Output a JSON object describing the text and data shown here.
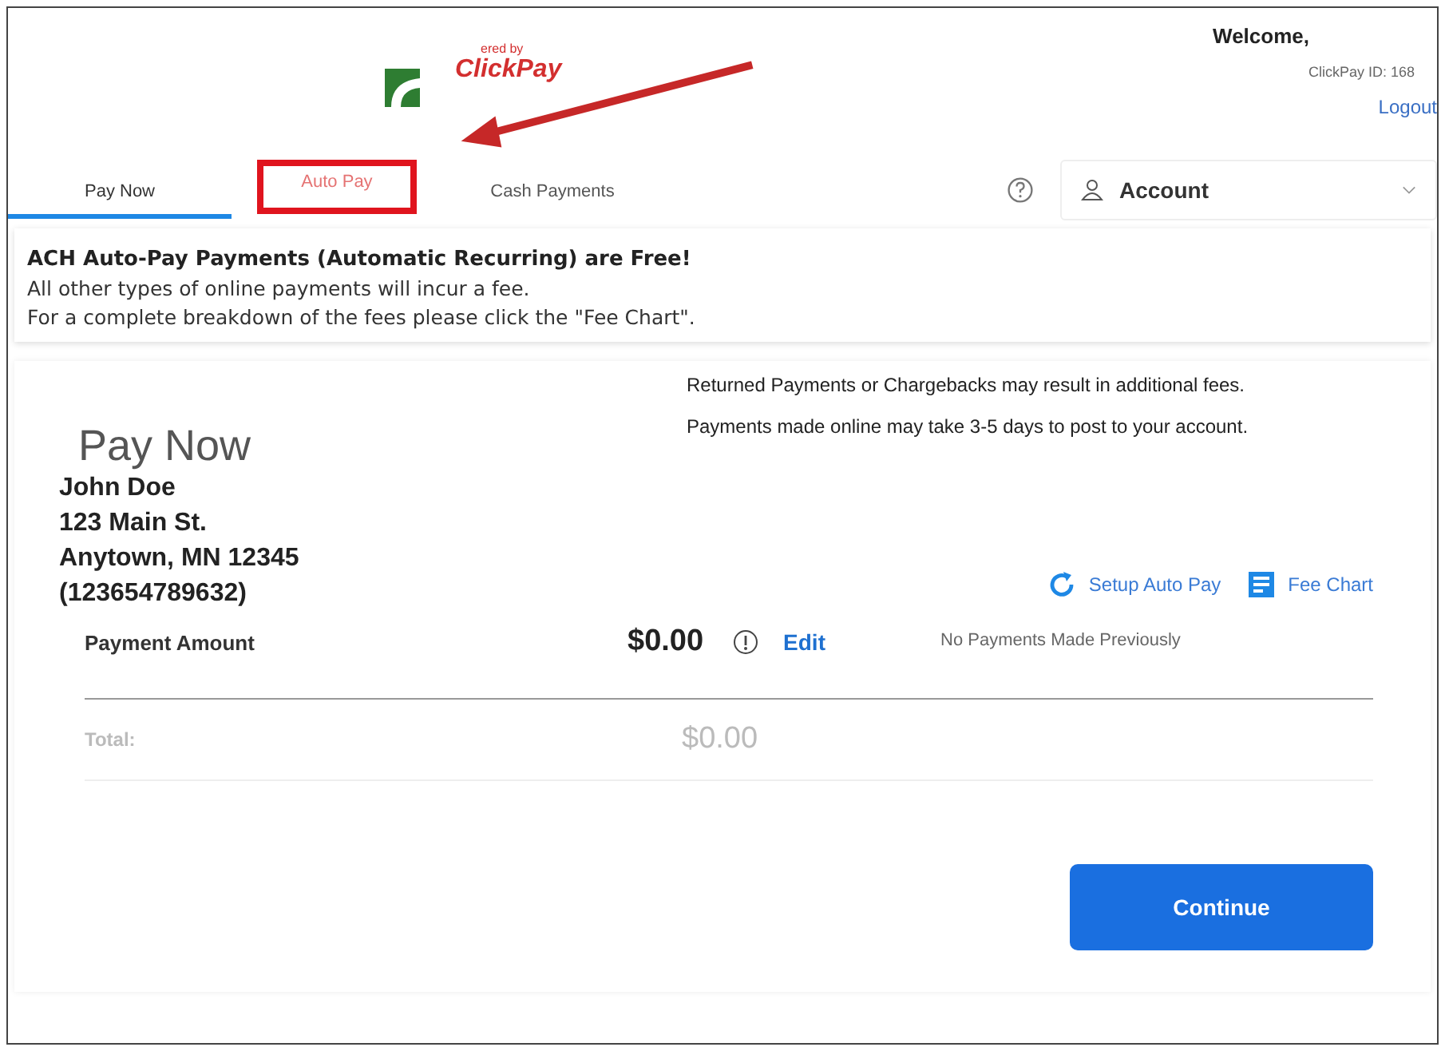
{
  "header": {
    "powered_by": "ered by",
    "brand": "ClickPay",
    "welcome": "Welcome,",
    "client_id": "ClickPay ID: 168",
    "logout": "Logout"
  },
  "tabs": [
    {
      "label": "Pay Now",
      "selected": true,
      "highlighted": false
    },
    {
      "label": "Auto Pay",
      "selected": false,
      "highlighted": true
    },
    {
      "label": "Cash Payments",
      "selected": false,
      "highlighted": false
    }
  ],
  "account_menu": {
    "label": "Account"
  },
  "notice": {
    "headline": "ACH Auto-Pay Payments (Automatic Recurring) are Free!",
    "lines": [
      "All other types of online payments will incur a fee.",
      "For a complete breakdown of the fees please click the \"Fee Chart\"."
    ]
  },
  "disclaimers": [
    "Returned Payments or Chargebacks may result in additional fees.",
    "Payments made online may take 3-5 days to post to your account."
  ],
  "pay_now": {
    "title": "Pay Now",
    "address": [
      "John Doe",
      "123 Main St.",
      "Anytown, MN 12345",
      "(123654789632)"
    ],
    "links": [
      {
        "kind": "autopay",
        "label": "Setup Auto Pay"
      },
      {
        "kind": "feechart",
        "label": "Fee Chart"
      }
    ],
    "payment_label": "Payment Amount",
    "amount": "$0.00",
    "edit": "Edit",
    "history": "No Payments Made Previously",
    "total_label": "Total:",
    "total": "$0.00",
    "continue": "Continue"
  }
}
